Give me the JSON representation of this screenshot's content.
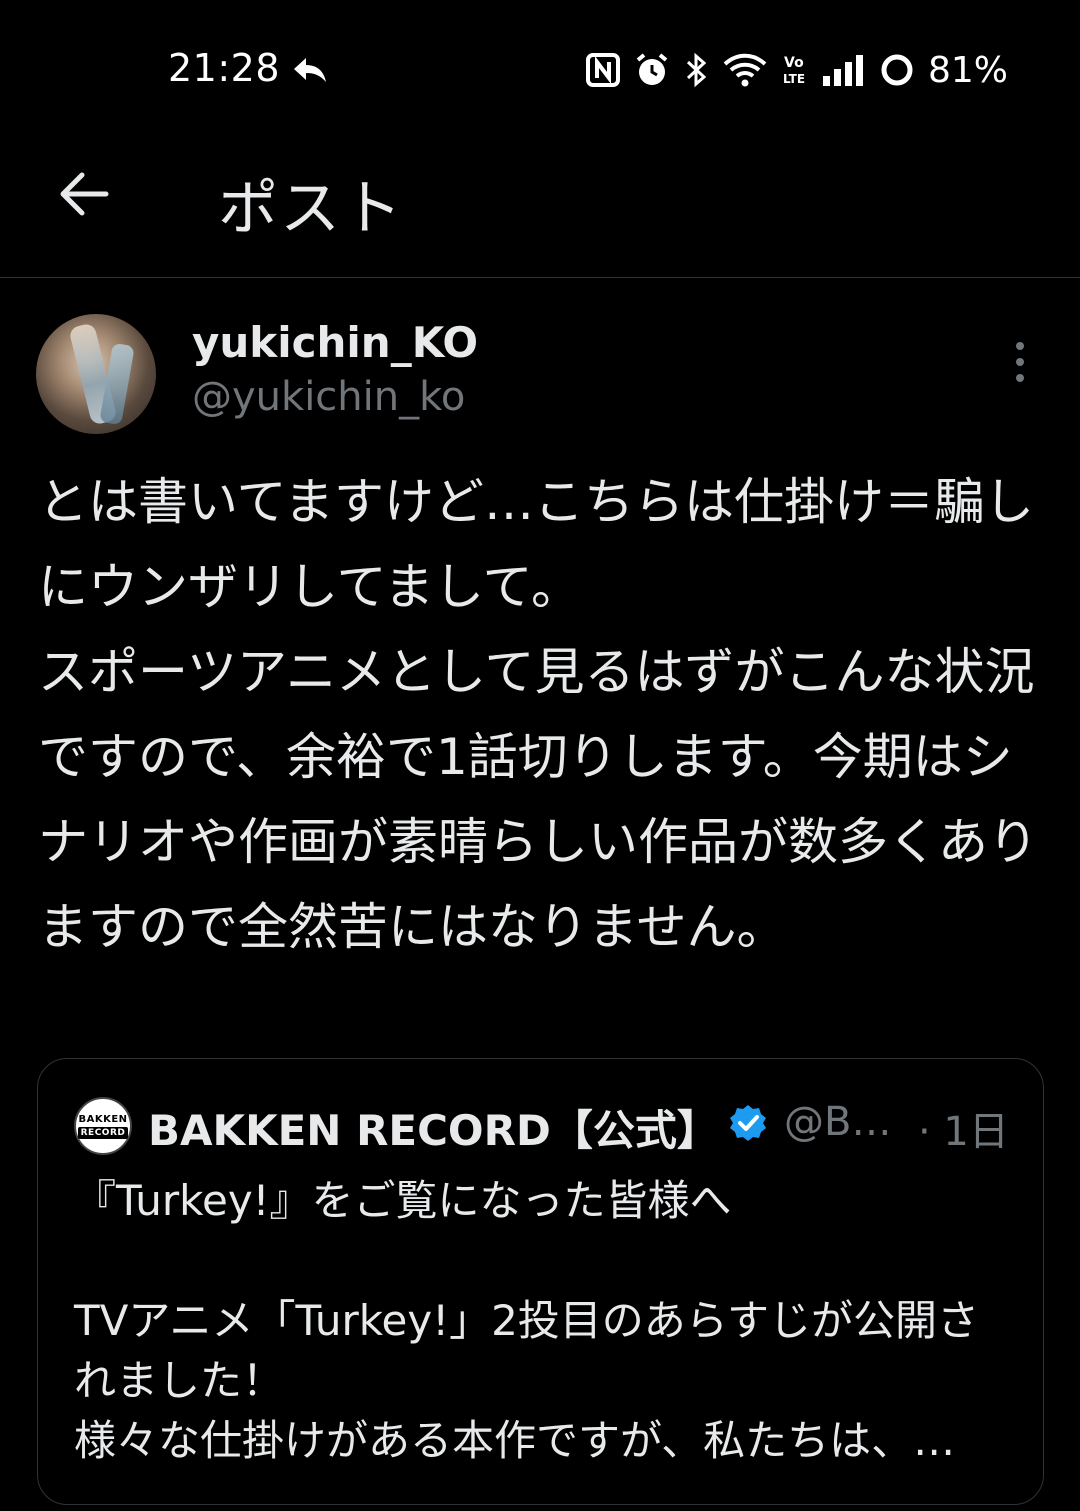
{
  "status_bar": {
    "time": "21:28",
    "battery": "81%",
    "icons": [
      "reply-arrow-icon",
      "nfc-icon",
      "alarm-icon",
      "bluetooth-icon",
      "wifi-icon",
      "volte-icon",
      "signal-icon",
      "battery-icon"
    ]
  },
  "header": {
    "title": "ポスト",
    "back_icon": "arrow-left-icon"
  },
  "post": {
    "display_name": "yukichin_KO",
    "handle": "@yukichin_ko",
    "text": "とは書いてますけど…こちらは仕掛け＝騙しにウンザリしてまして。\nスポーツアニメとして見るはずがこんな状況ですので、余裕で1話切りします。今期はシナリオや作画が素晴らしい作品が数多くありますので全然苦にはなりません。"
  },
  "quote": {
    "avatar_text_top": "BAKKEN",
    "avatar_text_bottom": "RECORD",
    "display_name": "BAKKEN RECORD【公式】",
    "handle": "@B…",
    "time": "· 1日",
    "text": "『Turkey!』をご覧になった皆様へ\n\nTVアニメ「Turkey!」2投目のあらすじが公開されました！\n様々な仕掛けがある本作ですが、私たちは、…"
  },
  "colors": {
    "background": "#000000",
    "text_primary": "#e7e9ea",
    "text_secondary": "#71767b",
    "border": "#2f3336",
    "verified": "#1d9bf0"
  }
}
